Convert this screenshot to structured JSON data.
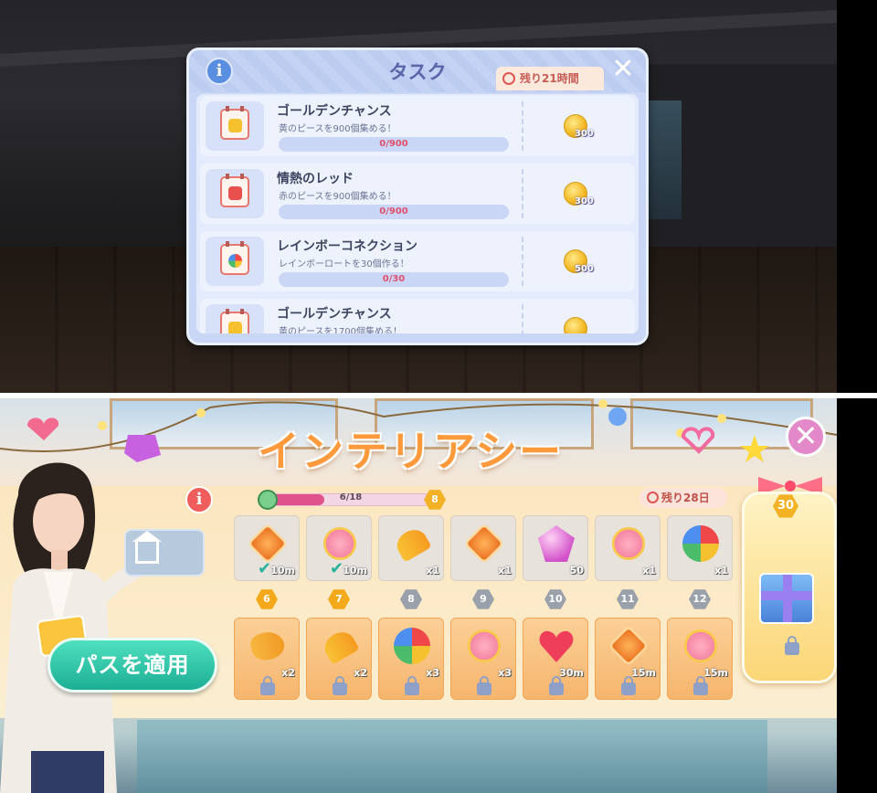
{
  "task_dialog": {
    "title": "タスク",
    "timer": "残り21時間",
    "info_icon": "i",
    "close_icon": "✕",
    "tasks": [
      {
        "name": "ゴールデンチャンス",
        "desc": "黄のピースを900個集める！",
        "progress": "0/900",
        "reward": "300",
        "icon_color": "#f5c12f"
      },
      {
        "name": "情熱のレッド",
        "desc": "赤のピースを900個集める！",
        "progress": "0/900",
        "reward": "300",
        "icon_color": "#e8504d"
      },
      {
        "name": "レインボーコネクション",
        "desc": "レインボーロートを30個作る！",
        "progress": "0/30",
        "reward": "500",
        "icon_color": "rainbow"
      },
      {
        "name": "ゴールデンチャンス",
        "desc": "黄のピースを1700個集める！",
        "progress": "",
        "reward": "",
        "icon_color": "#f5c12f"
      }
    ]
  },
  "pass": {
    "title": "インテリアシー",
    "info_icon": "i",
    "close_icon": "✕",
    "progress_text": "6/18",
    "progress_fraction": 0.333,
    "current_level": "8",
    "remaining": "残り28日",
    "apply_button": "パスを適用",
    "big_reward_level": "30",
    "levels": [
      "6",
      "7",
      "8",
      "9",
      "10",
      "11",
      "12"
    ],
    "free_rewards": [
      {
        "item": "leaf-icon",
        "amount": "10m",
        "claimed": true
      },
      {
        "item": "candy-icon",
        "amount": "10m",
        "claimed": true
      },
      {
        "item": "brush-icon",
        "amount": "x1",
        "claimed": false
      },
      {
        "item": "leaf-icon",
        "amount": "x1",
        "claimed": false
      },
      {
        "item": "gem-icon",
        "amount": "50",
        "claimed": false
      },
      {
        "item": "candy-icon",
        "amount": "x1",
        "claimed": false
      },
      {
        "item": "ball-icon",
        "amount": "x1",
        "claimed": false
      }
    ],
    "premium_rewards": [
      {
        "item": "hairdryer-icon",
        "amount": "x2"
      },
      {
        "item": "brush-icon",
        "amount": "x2"
      },
      {
        "item": "ball-icon",
        "amount": "x3"
      },
      {
        "item": "candy-icon",
        "amount": "x3"
      },
      {
        "item": "heart-icon",
        "amount": "30m"
      },
      {
        "item": "leaf-icon",
        "amount": "15m"
      },
      {
        "item": "candy-icon",
        "amount": "15m"
      }
    ]
  }
}
